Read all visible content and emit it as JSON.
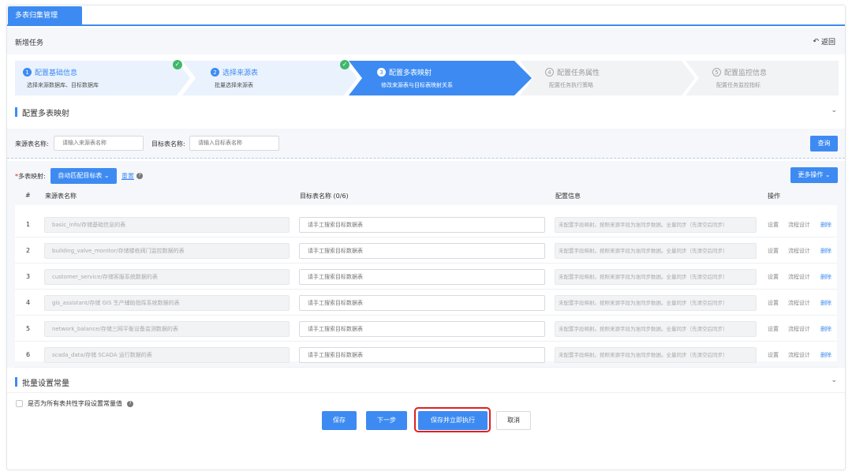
{
  "tab": {
    "label": "多表归集管理"
  },
  "header": {
    "title": "新增任务",
    "back_label": "返回"
  },
  "steps": [
    {
      "num": "1",
      "label": "配置基础信息",
      "desc": "选择来源数据库、目标数据库",
      "state": "done"
    },
    {
      "num": "2",
      "label": "选择来源表",
      "desc": "批量选择来源表",
      "state": "done"
    },
    {
      "num": "3",
      "label": "配置多表映射",
      "desc": "修改来源表与目标表映射关系",
      "state": "active"
    },
    {
      "num": "4",
      "label": "配置任务属性",
      "desc": "配置任务执行策略",
      "state": "todo"
    },
    {
      "num": "5",
      "label": "配置监控信息",
      "desc": "配置任务监控指标",
      "state": "todo"
    }
  ],
  "section_mapping": {
    "title": "配置多表映射"
  },
  "search": {
    "source_label": "来源表名称:",
    "source_placeholder": "请输入来源表名称",
    "target_label": "目标表名称:",
    "target_placeholder": "请输入目标表名称",
    "query_label": "查询"
  },
  "mapping": {
    "required_mark": "*",
    "label": "多表映射:",
    "auto_match_label": "自动匹配目标表",
    "reset_label": "重置",
    "more_label": "更多操作"
  },
  "table": {
    "headers": {
      "index": "#",
      "source": "来源表名称",
      "target": "目标表名称 (0/6)",
      "config": "配置信息",
      "actions": "操作"
    },
    "rows": [
      {
        "index": "1",
        "source": "basic_info/存储基础信息的表",
        "target_placeholder": "请手工搜索目标数据表",
        "config": "未配置字段映射。按照来源字段为准同步数据。全量同步（先清空后同步）",
        "set": "设置",
        "flow": "流程设计",
        "del": "删除"
      },
      {
        "index": "2",
        "source": "building_valve_monitor/存储楼栋阀门监控数据的表",
        "target_placeholder": "请手工搜索目标数据表",
        "config": "未配置字段映射。按照来源字段为准同步数据。全量同步（先清空后同步）",
        "set": "设置",
        "flow": "流程设计",
        "del": "删除"
      },
      {
        "index": "3",
        "source": "customer_service/存储客服系统数据的表",
        "target_placeholder": "请手工搜索目标数据表",
        "config": "未配置字段映射。按照来源字段为准同步数据。全量同步（先清空后同步）",
        "set": "设置",
        "flow": "流程设计",
        "del": "删除"
      },
      {
        "index": "4",
        "source": "gis_assistant/存储 GIS 生产辅助指挥系统数据的表",
        "target_placeholder": "请手工搜索目标数据表",
        "config": "未配置字段映射。按照来源字段为准同步数据。全量同步（先清空后同步）",
        "set": "设置",
        "flow": "流程设计",
        "del": "删除"
      },
      {
        "index": "5",
        "source": "network_balance/存储三网平衡设备监测数据的表",
        "target_placeholder": "请手工搜索目标数据表",
        "config": "未配置字段映射。按照来源字段为准同步数据。全量同步（先清空后同步）",
        "set": "设置",
        "flow": "流程设计",
        "del": "删除"
      },
      {
        "index": "6",
        "source": "scada_data/存储 SCADA 运行数据的表",
        "target_placeholder": "请手工搜索目标数据表",
        "config": "未配置字段映射。按照来源字段为准同步数据。全量同步（先清空后同步）",
        "set": "设置",
        "flow": "流程设计",
        "del": "删除"
      }
    ]
  },
  "section_constant": {
    "title": "批量设置常量"
  },
  "constant": {
    "checkbox_label": "是否为所有表共性字段设置常量值"
  },
  "footer": {
    "save": "保存",
    "next": "下一步",
    "save_run": "保存并立即执行",
    "cancel": "取消"
  },
  "colors": {
    "accent": "#3d8bf2",
    "success": "#41b86b",
    "highlight": "#e02020"
  }
}
